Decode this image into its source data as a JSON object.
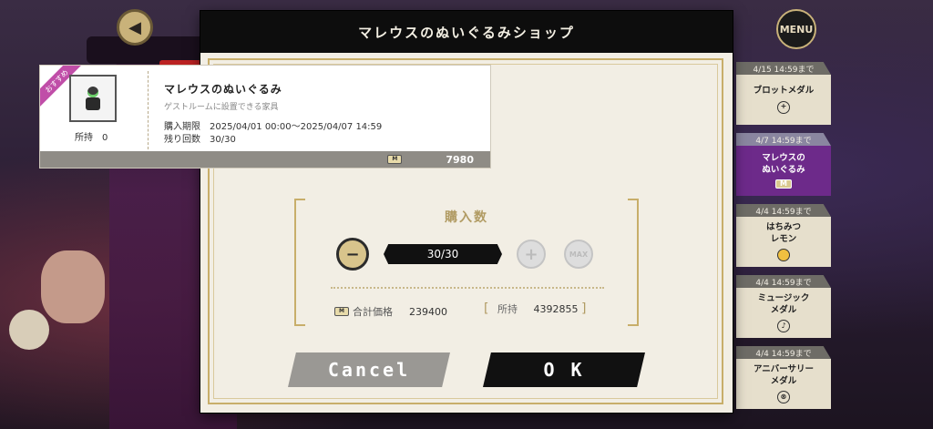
{
  "dialog": {
    "title": "マレウスのぬいぐるみショップ"
  },
  "nav": {
    "menu_label": "MENU"
  },
  "item": {
    "recommend_badge": "おすすめ",
    "name": "マレウスのぬいぐるみ",
    "description": "ゲストルームに設置できる家具",
    "owned_label": "所持",
    "owned_value": "0",
    "period_label": "購入期限",
    "period_value": "2025/04/01 00:00～2025/04/07 14:59",
    "remaining_label": "残り回数",
    "remaining_value": "30/30",
    "price": "7980",
    "currency_icon_text": "M"
  },
  "purchase": {
    "title": "購入数",
    "quantity": "30/30",
    "minus_symbol": "−",
    "plus_symbol": "+",
    "max_label": "MAX",
    "total_label": "合計価格",
    "total_value": "239400",
    "owned_label": "所持",
    "owned_value": "4392855",
    "bracket_open": "[",
    "bracket_close": "]"
  },
  "buttons": {
    "cancel": "Cancel",
    "ok": "O K"
  },
  "side_tabs": [
    {
      "date": "4/15 14:59まで",
      "line1": "ブロットメダル",
      "line2": "",
      "icon": "+",
      "active": false
    },
    {
      "date": "4/7 14:59まで",
      "line1": "マレウスの",
      "line2": "ぬいぐるみ",
      "icon": "M",
      "active": true
    },
    {
      "date": "4/4 14:59まで",
      "line1": "はちみつ",
      "line2": "レモン",
      "icon": "",
      "active": false
    },
    {
      "date": "4/4 14:59まで",
      "line1": "ミュージック",
      "line2": "メダル",
      "icon": "♪",
      "active": false
    },
    {
      "date": "4/4 14:59まで",
      "line1": "アニバーサリー",
      "line2": "メダル",
      "icon": "⊗",
      "active": false
    }
  ],
  "colors": {
    "gold": "#c8ae6a",
    "dialog_bg": "#f2eee4",
    "header_bg": "#0d0d0d",
    "active_tab": "#6d2a8a"
  }
}
